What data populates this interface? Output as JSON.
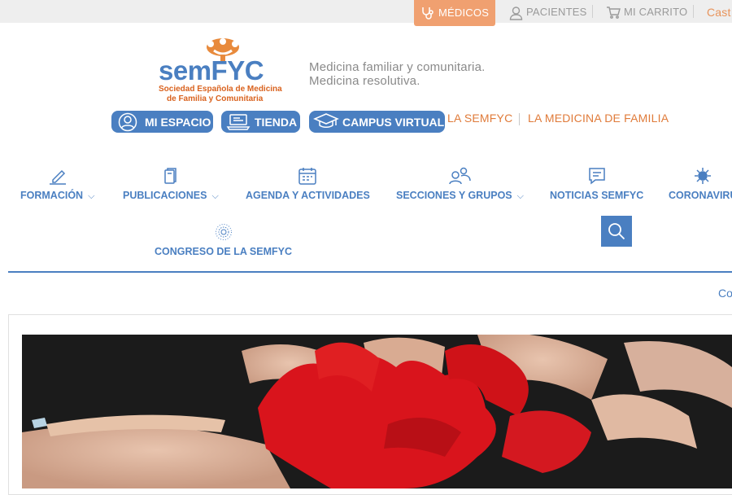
{
  "topbar": {
    "medicos": "MÉDICOS",
    "pacientes": "PACIENTES",
    "carrito": "MI CARRITO",
    "language": "Cast"
  },
  "logo": {
    "brand": "semFYC",
    "line1": "Sociedad Española de Medicina",
    "line2": "de Familia y Comunitaria"
  },
  "tagline": {
    "line1": "Medicina familiar y comunitaria.",
    "line2": "Medicina resolutiva."
  },
  "quick_buttons": {
    "mi_espacio": "MI ESPACIO",
    "tienda": "TIENDA",
    "campus": "CAMPUS VIRTUAL"
  },
  "top_links": {
    "la_semfyc": "LA SEMFYC",
    "medicina_familia": "LA MEDICINA DE FAMILIA"
  },
  "nav": {
    "formacion": "FORMACIÓN",
    "publicaciones": "PUBLICACIONES",
    "agenda": "AGENDA Y ACTIVIDADES",
    "secciones": "SECCIONES Y GRUPOS",
    "noticias": "NOTICIAS SEMFYC",
    "coronavirus": "CORONAVIRU",
    "congreso": "CONGRESO DE LA SEMFYC",
    "chevron": "⌵"
  },
  "breadcrumb_text": "Co",
  "colors": {
    "primary_blue": "#4a7fc1",
    "accent_orange": "#e07b3a",
    "medicos_bg": "#f0a070",
    "topbar_bg": "#eeeeee"
  },
  "icons": {
    "medicos": "stethoscope-icon",
    "pacientes": "user-icon",
    "carrito": "cart-icon",
    "mi_espacio": "user-circle-icon",
    "tienda": "laptop-icon",
    "campus": "graduation-cap-icon",
    "formacion": "pencil-icon",
    "publicaciones": "books-icon",
    "agenda": "calendar-icon",
    "secciones": "group-icon",
    "noticias": "chat-icon",
    "coronavirus": "virus-icon",
    "congreso": "radial-icon",
    "search": "search-icon"
  }
}
